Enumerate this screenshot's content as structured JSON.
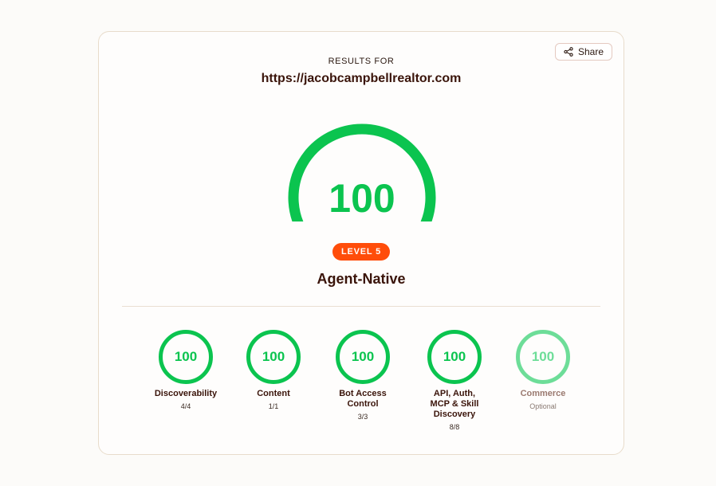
{
  "share": {
    "label": "Share"
  },
  "header": {
    "results_for": "RESULTS FOR",
    "url": "https://jacobcampbellrealtor.com"
  },
  "score": {
    "value": "100",
    "fraction": 1.0
  },
  "level": {
    "badge": "LEVEL 5",
    "name": "Agent-Native"
  },
  "colors": {
    "accent": "#0bc44f",
    "badge": "#ff4d0a",
    "text": "#3a140a"
  },
  "categories": [
    {
      "score": "100",
      "name": "Discoverability",
      "detail": "4/4"
    },
    {
      "score": "100",
      "name": "Content",
      "detail": "1/1"
    },
    {
      "score": "100",
      "name": "Bot Access Control",
      "detail": "3/3"
    },
    {
      "score": "100",
      "name": "API, Auth, MCP & Skill Discovery",
      "detail": "8/8"
    },
    {
      "score": "100",
      "name": "Commerce",
      "detail": "Optional"
    }
  ]
}
